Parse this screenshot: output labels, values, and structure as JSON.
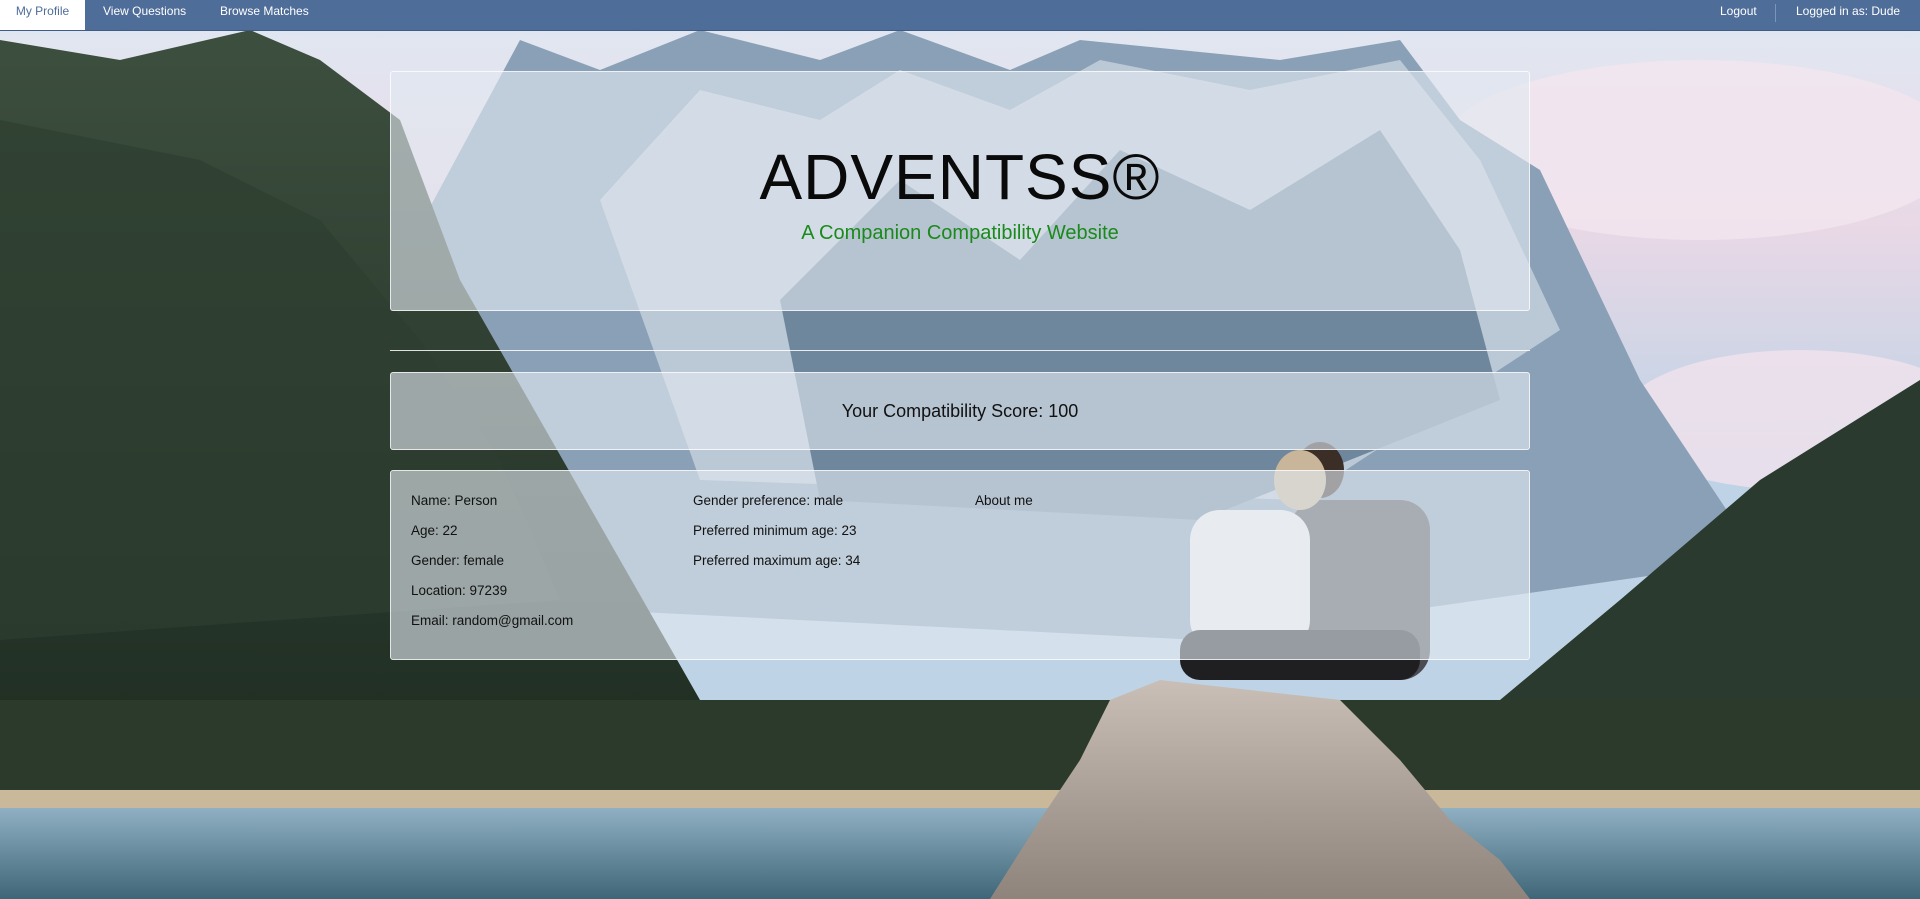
{
  "nav": {
    "my_profile": "My Profile",
    "view_questions": "View Questions",
    "browse_matches": "Browse Matches",
    "logout": "Logout",
    "logged_in": "Logged in as: Dude"
  },
  "hero": {
    "title": "ADVENTSS®",
    "subtitle": "A Companion Compatibility Website"
  },
  "score": {
    "label": "Your Compatibility Score: 100"
  },
  "profile": {
    "col1": [
      "Name: Person",
      "Age: 22",
      "Gender: female",
      "Location: 97239",
      "Email: random@gmail.com"
    ],
    "col2": [
      "Gender preference: male",
      "Preferred minimum age: 23",
      "Preferred maximum age: 34"
    ],
    "col3": [
      "About me"
    ]
  },
  "colors": {
    "nav_bg": "#4f6d99",
    "subtitle": "#1a8a1a"
  }
}
